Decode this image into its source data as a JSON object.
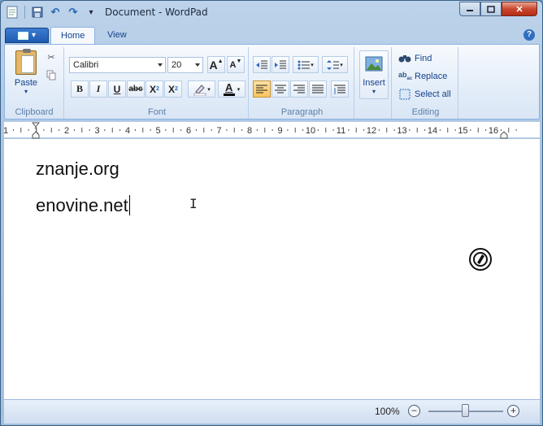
{
  "window": {
    "title": "Document - WordPad",
    "controls": {
      "minimize": "▁",
      "maximize": "□",
      "close": "✕"
    }
  },
  "quick_access": [
    {
      "name": "save-icon",
      "glyph": "💾"
    },
    {
      "name": "undo-icon",
      "glyph": "↶"
    },
    {
      "name": "redo-icon",
      "glyph": "↷"
    },
    {
      "name": "customize-qat-icon",
      "glyph": "▾"
    }
  ],
  "ribbon": {
    "tabs": [
      "Home",
      "View"
    ],
    "active_tab": "Home",
    "help": "?",
    "clipboard": {
      "label": "Clipboard",
      "paste_label": "Paste"
    },
    "font": {
      "label": "Font",
      "family": "Calibri",
      "size": "20",
      "grow": "A",
      "shrink": "A",
      "bold": "B",
      "italic": "I",
      "underline": "U",
      "strikethrough": "abc",
      "subscript": "X",
      "superscript": "X",
      "font_color": "A",
      "font_color_hex": "#000000",
      "highlight_color_hex": "#ffffff"
    },
    "paragraph": {
      "label": "Paragraph"
    },
    "insert": {
      "label": "Insert"
    },
    "editing": {
      "label": "Editing",
      "find": "Find",
      "replace": "Replace",
      "select_all": "Select all"
    }
  },
  "ruler": {
    "labels": [
      "1",
      "1",
      "2",
      "3",
      "4",
      "5",
      "6",
      "7",
      "8",
      "9",
      "10",
      "11",
      "12",
      "13",
      "14",
      "15",
      "16"
    ]
  },
  "document": {
    "lines": [
      "znanje.org",
      "enovine.net"
    ]
  },
  "status_bar": {
    "zoom": "100%",
    "zoom_out": "−",
    "zoom_in": "+",
    "zoom_level_fraction": 0.5
  },
  "colors": {
    "accent": "#15428b",
    "ribbon_bg": "#e3edf9",
    "pressed": "#fbc45a"
  }
}
